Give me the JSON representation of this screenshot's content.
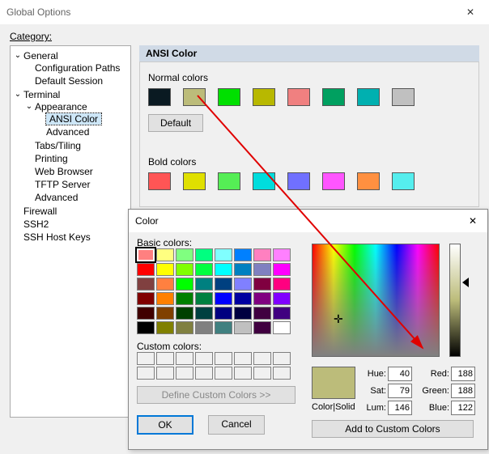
{
  "window": {
    "title": "Global Options",
    "close_glyph": "✕"
  },
  "category_label": "Category:",
  "tree": {
    "general": {
      "label": "General",
      "children": {
        "config_paths": "Configuration Paths",
        "default_session": "Default Session"
      }
    },
    "terminal": {
      "label": "Terminal",
      "children": {
        "appearance": {
          "label": "Appearance",
          "children": {
            "ansi_color": "ANSI Color",
            "advanced": "Advanced"
          }
        },
        "tabs_tiling": "Tabs/Tiling",
        "printing": "Printing",
        "web_browser": "Web Browser",
        "tftp_server": "TFTP Server",
        "advanced": "Advanced"
      }
    },
    "firewall": "Firewall",
    "ssh2": "SSH2",
    "ssh_host_keys": "SSH Host Keys"
  },
  "panel": {
    "title": "ANSI Color",
    "normal_label": "Normal colors",
    "default_btn": "Default",
    "bold_label": "Bold colors",
    "normal_colors": [
      "#0a1a22",
      "#bcbc7a",
      "#00e000",
      "#b8b800",
      "#f08080",
      "#00a060",
      "#00b0b0",
      "#c0c0c0"
    ],
    "bold_colors": [
      "#ff5555",
      "#e0e000",
      "#55ee55",
      "#00dddd",
      "#7070ff",
      "#ff55ff",
      "#ff9040",
      "#55eeee"
    ]
  },
  "dialog": {
    "title": "Color",
    "close_glyph": "✕",
    "basic_colors_label": "Basic colors:",
    "custom_colors_label": "Custom colors:",
    "define_btn": "Define Custom Colors >>",
    "ok_btn": "OK",
    "cancel_btn": "Cancel",
    "preview_label": "Color|Solid",
    "add_btn": "Add to Custom Colors",
    "basic_colors": [
      "#ff8080",
      "#ffff80",
      "#80ff80",
      "#00ff80",
      "#80ffff",
      "#0080ff",
      "#ff80c0",
      "#ff80ff",
      "#ff0000",
      "#ffff00",
      "#80ff00",
      "#00ff40",
      "#00ffff",
      "#0080c0",
      "#8080c0",
      "#ff00ff",
      "#804040",
      "#ff8040",
      "#00ff00",
      "#008080",
      "#004080",
      "#8080ff",
      "#800040",
      "#ff0080",
      "#800000",
      "#ff8000",
      "#008000",
      "#008040",
      "#0000ff",
      "#0000a0",
      "#800080",
      "#8000ff",
      "#400000",
      "#804000",
      "#004000",
      "#004040",
      "#000080",
      "#000040",
      "#400040",
      "#400080",
      "#000000",
      "#808000",
      "#808040",
      "#808080",
      "#408080",
      "#c0c0c0",
      "#400040",
      "#ffffff"
    ],
    "selected_basic_index": 0,
    "hsl": {
      "hue_label": "Hue:",
      "sat_label": "Sat:",
      "lum_label": "Lum:",
      "hue": "40",
      "sat": "79",
      "lum": "146"
    },
    "rgb": {
      "red_label": "Red:",
      "green_label": "Green:",
      "blue_label": "Blue:",
      "red": "188",
      "green": "188",
      "blue": "122"
    }
  },
  "expand_glyph": "⌄"
}
